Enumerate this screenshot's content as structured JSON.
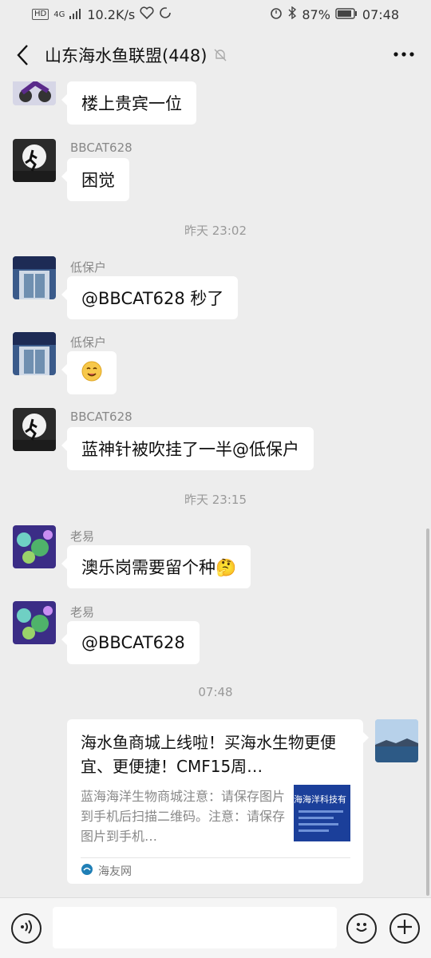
{
  "status_bar": {
    "network_badge": "HD",
    "network_type": "4G",
    "speed": "10.2K/s",
    "battery": "87%",
    "time": "07:48"
  },
  "header": {
    "title": "山东海水鱼联盟(448)"
  },
  "messages": [
    {
      "sender": "",
      "text": "楼上贵宾一位",
      "avatar_icon": "motorcycle-avatar"
    },
    {
      "sender": "BBCAT628",
      "text": "困觉",
      "avatar_icon": "runner-moon-avatar"
    },
    {
      "timestamp": "昨天 23:02"
    },
    {
      "sender": "低保户",
      "text": "@BBCAT628  秒了",
      "avatar_icon": "shop-front-avatar"
    },
    {
      "sender": "低保户",
      "text": "😋",
      "avatar_icon": "shop-front-avatar"
    },
    {
      "sender": "BBCAT628",
      "text": "蓝神针被吹挂了一半@低保户",
      "avatar_icon": "runner-moon-avatar"
    },
    {
      "timestamp": "昨天 23:15"
    },
    {
      "sender": "老易",
      "text": "澳乐岗需要留个种🤔",
      "avatar_icon": "coral-avatar"
    },
    {
      "sender": "老易",
      "text": "@BBCAT628",
      "avatar_icon": "coral-avatar"
    },
    {
      "timestamp": "07:48"
    }
  ],
  "link_card": {
    "title": "海水鱼商城上线啦！买海水生物更便宜、更便捷！CMF15周…",
    "description": "蓝海海洋生物商城注意：请保存图片到手机后扫描二维码。注意：请保存图片到手机…",
    "thumbnail_text": "海海洋科技有",
    "source": "海友网",
    "avatar_icon": "sea-landscape-avatar"
  },
  "input_bar": {
    "placeholder": ""
  },
  "colors": {
    "background": "#ededed",
    "bubble": "#ffffff",
    "muted_text": "#888888"
  }
}
